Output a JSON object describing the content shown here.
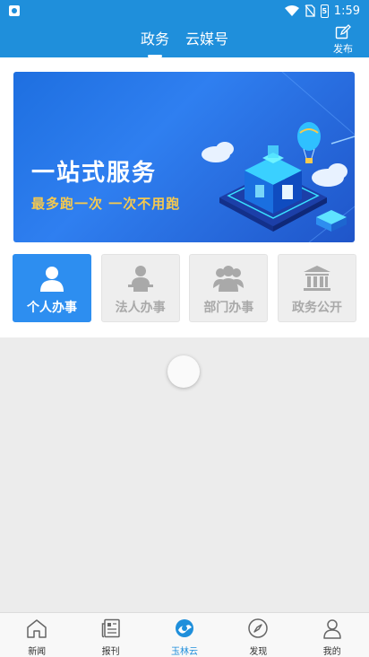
{
  "status_bar": {
    "time": "1:59",
    "battery_label": "5"
  },
  "header": {
    "tabs": [
      {
        "label": "政务",
        "active": true
      },
      {
        "label": "云媒号",
        "active": false
      }
    ],
    "publish_label": "发布",
    "publish_icon": "edit-icon"
  },
  "banner": {
    "title": "一站式服务",
    "subtitle": "最多跑一次  一次不用跑"
  },
  "services": [
    {
      "label": "个人办事",
      "icon": "person-icon",
      "active": true
    },
    {
      "label": "法人办事",
      "icon": "legal-person-icon",
      "active": false
    },
    {
      "label": "部门办事",
      "icon": "group-icon",
      "active": false
    },
    {
      "label": "政务公开",
      "icon": "government-building-icon",
      "active": false
    }
  ],
  "bottom_nav": [
    {
      "label": "新闻",
      "icon": "home-icon",
      "active": false
    },
    {
      "label": "报刊",
      "icon": "newspaper-icon",
      "active": false
    },
    {
      "label": "玉林云",
      "icon": "yulin-cloud-icon",
      "active": true
    },
    {
      "label": "发现",
      "icon": "compass-icon",
      "active": false
    },
    {
      "label": "我的",
      "icon": "user-icon",
      "active": false
    }
  ],
  "colors": {
    "brand": "#1f8fdb",
    "active_service": "#2d8ef0",
    "banner_accent": "#f6c94e"
  }
}
